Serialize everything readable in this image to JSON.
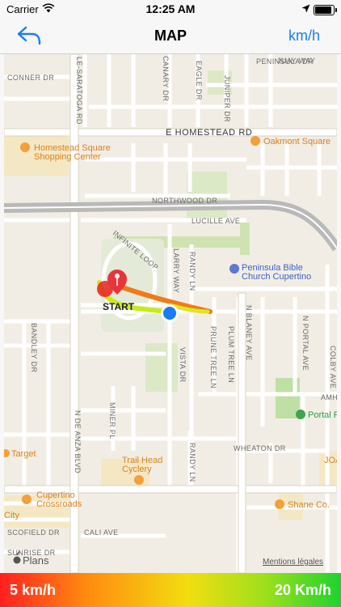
{
  "status_bar": {
    "carrier": "Carrier",
    "time": "12:25 AM",
    "icons": [
      "wifi-icon",
      "location-arrow-icon",
      "battery-icon"
    ]
  },
  "nav": {
    "title": "MAP",
    "unit_button": "km/h",
    "back_icon": "back-arrow-icon"
  },
  "map": {
    "streets": {
      "saratoga": "LE-SARATOGA RD",
      "conner": "CONNER DR",
      "canary": "CANARY DR",
      "eagle": "EAGLE DR",
      "juniper": "JUNIPER DR",
      "peninsula": "PENINSULA DR",
      "juay": "JUAY WAY",
      "homestead": "E HOMESTEAD RD",
      "northwood": "NORTHWOOD DR",
      "lucille": "LUCILLE AVE",
      "infinite_loop": "INFINITE LOOP",
      "larry": "LARRY WAY",
      "randy1": "RANDY LN",
      "randy2": "RANDY LN",
      "blaney": "N BLANEY AVE",
      "bandley": "BANDLEY DR",
      "vista": "VISTA DR",
      "prune_tree": "PRUNE TREE LN",
      "plum_tree": "PLUM TREE LN",
      "n_portal": "N PORTAL AVE",
      "colby": "COLBY AVE",
      "amh": "AMH",
      "de_anza": "N DE ANZA BLVD",
      "miner": "MINER PL",
      "wheaton": "WHEATON DR",
      "cali": "CALI AVE",
      "scofield": "SCOFIELD DR",
      "sunrise": "SUNRISE DR"
    },
    "pois": {
      "homestead_square": [
        "Homestead Square",
        "Shopping Center"
      ],
      "oakmont": "Oakmont Square",
      "peninsula_bible": [
        "Peninsula Bible",
        "Church Cupertino"
      ],
      "portal_park": "Portal P",
      "target": "Target",
      "trail_head": [
        "Trail Head",
        "Cyclery"
      ],
      "cupertino_crossroads": [
        "Cupertino",
        "Crossroads"
      ],
      "city": "City",
      "shane": "Shane Co.",
      "joa": "JOA"
    },
    "start_label": "START",
    "attribution": "Plans",
    "legal": "Mentions légales",
    "icons": [
      "start-pin-icon",
      "current-location-dot-icon",
      "apple-logo-icon"
    ]
  },
  "legend": {
    "min": "5 km/h",
    "max": "20 Km/h"
  },
  "colors": {
    "accent": "#1a7cf5",
    "route_start": "#e8161a",
    "route_end": "#c5ea1e",
    "legend_low": "#ff1f1f",
    "legend_high": "#1ed230"
  }
}
